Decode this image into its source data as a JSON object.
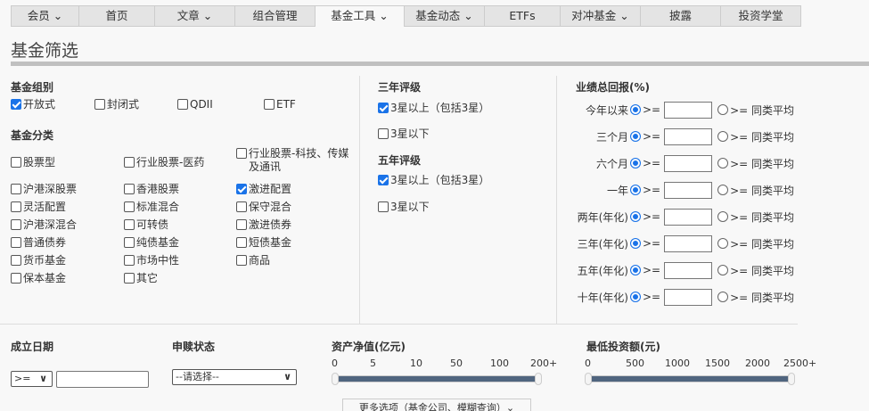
{
  "nav": [
    {
      "label": "会员 ⌄"
    },
    {
      "label": "首页"
    },
    {
      "label": "文章 ⌄"
    },
    {
      "label": "组合管理"
    },
    {
      "label": "基金工具 ⌄"
    },
    {
      "label": "基金动态 ⌄"
    },
    {
      "label": "ETFs"
    },
    {
      "label": "对冲基金 ⌄"
    },
    {
      "label": "披露"
    },
    {
      "label": "投资学堂"
    }
  ],
  "title": "基金筛选",
  "group": {
    "heading": "基金组别",
    "items": [
      "开放式",
      "封闭式",
      "QDII",
      "ETF"
    ]
  },
  "category": {
    "heading": "基金分类",
    "items": [
      "股票型",
      "行业股票-医药",
      "行业股票-科技、传媒及通讯",
      "沪港深股票",
      "香港股票",
      "激进配置",
      "灵活配置",
      "标准混合",
      "保守混合",
      "沪港深混合",
      "可转债",
      "激进债券",
      "普通债券",
      "纯债基金",
      "短债基金",
      "货币基金",
      "市场中性",
      "商品",
      "保本基金",
      "其它"
    ]
  },
  "rating3": {
    "heading": "三年评级",
    "items": [
      "3星以上（包括3星）",
      "3星以下"
    ]
  },
  "rating5": {
    "heading": "五年评级",
    "items": [
      "3星以上（包括3星）",
      "3星以下"
    ]
  },
  "returns": {
    "heading": "业绩总回报(%)",
    "ge": ">=",
    "avg": ">= 同类平均",
    "rows": [
      "今年以来",
      "三个月",
      "六个月",
      "一年",
      "两年(年化)",
      "三年(年化)",
      "五年(年化)",
      "十年(年化)"
    ]
  },
  "inception": {
    "heading": "成立日期",
    "op": ">=",
    "value": ""
  },
  "status": {
    "heading": "申赎状态",
    "value": "--请选择--"
  },
  "nav_size": {
    "heading": "资产净值(亿元)",
    "ticks": [
      "0",
      "5",
      "10",
      "50",
      "100",
      "200+"
    ],
    "range": [
      "0",
      "200+"
    ]
  },
  "min_invest": {
    "heading": "最低投资额(元)",
    "ticks": [
      "0",
      "500",
      "1000",
      "1500",
      "2000",
      "2500+"
    ],
    "range": [
      "0",
      "2500+"
    ]
  },
  "more": "更多选项（基金公司、模糊查询）⌄"
}
